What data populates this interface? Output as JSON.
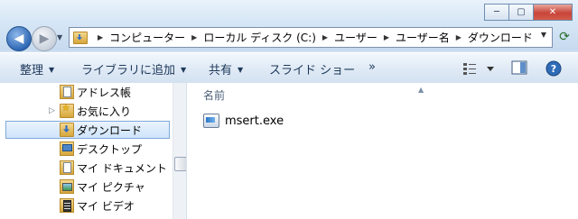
{
  "window": {
    "minimize_label": "─",
    "maximize_label": "▢",
    "close_label": "✕"
  },
  "address": {
    "crumbs": [
      "コンピューター",
      "ローカル ディスク (C:)",
      "ユーザー",
      "ユーザー名",
      "ダウンロード"
    ]
  },
  "toolbar": {
    "organize_label": "整理",
    "library_label": "ライブラリに追加",
    "share_label": "共有",
    "slideshow_label": "スライド ショー",
    "more_label": "»"
  },
  "tree": {
    "items": [
      {
        "label": "アドレス帳",
        "icon": "address-book-icon"
      },
      {
        "label": "お気に入り",
        "icon": "favorites-icon"
      },
      {
        "label": "ダウンロード",
        "icon": "downloads-folder-icon",
        "selected": true
      },
      {
        "label": "デスクトップ",
        "icon": "desktop-folder-icon"
      },
      {
        "label": "マイ ドキュメント",
        "icon": "documents-folder-icon"
      },
      {
        "label": "マイ ピクチャ",
        "icon": "pictures-folder-icon"
      },
      {
        "label": "マイ ビデオ",
        "icon": "videos-folder-icon"
      }
    ]
  },
  "content": {
    "column_name_label": "名前",
    "files": [
      {
        "name": "msert.exe",
        "icon": "exe-file-icon"
      }
    ]
  },
  "colors": {
    "chrome_blue": "#cfe0f1",
    "toolbar_text": "#1e395b",
    "selection_border": "#7fa9da"
  }
}
